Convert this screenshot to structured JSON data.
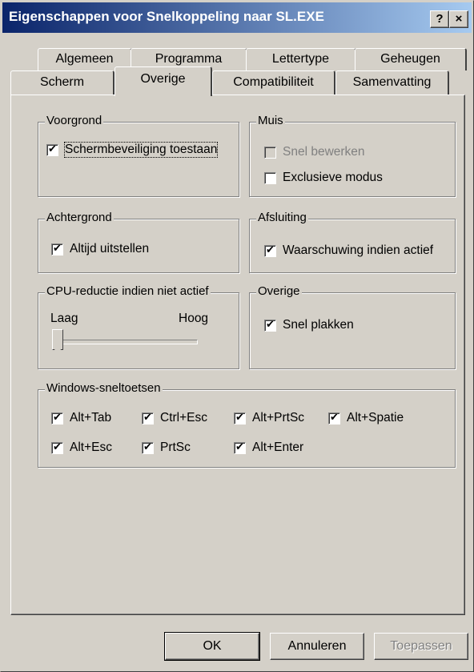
{
  "window": {
    "title": "Eigenschappen voor Snelkoppeling naar SL.EXE",
    "help_label": "?",
    "close_label": "×"
  },
  "tabs": {
    "row1": [
      "Algemeen",
      "Programma",
      "Lettertype",
      "Geheugen"
    ],
    "row2": [
      "Scherm",
      "Overige",
      "Compatibiliteit",
      "Samenvatting"
    ],
    "active": "Overige"
  },
  "voorgrond": {
    "label": "Voorgrond",
    "screensaver": {
      "label": "Schermbeveiliging toestaan",
      "checked": true
    }
  },
  "muis": {
    "label": "Muis",
    "quickedit": {
      "label": "Snel bewerken",
      "checked": false,
      "enabled": false
    },
    "exclusive": {
      "label": "Exclusieve modus",
      "checked": false
    }
  },
  "achtergrond": {
    "label": "Achtergrond",
    "always_suspend": {
      "label": "Altijd uitstellen",
      "checked": true
    }
  },
  "afsluiting": {
    "label": "Afsluiting",
    "warn": {
      "label": "Waarschuwing indien actief",
      "checked": true
    }
  },
  "cpu": {
    "label": "CPU-reductie indien niet actief",
    "low": "Laag",
    "high": "Hoog",
    "level": 0
  },
  "overige": {
    "label": "Overige",
    "fastpaste": {
      "label": "Snel plakken",
      "checked": true
    }
  },
  "shortcuts": {
    "label": "Windows-sneltoetsen",
    "items": [
      {
        "label": "Alt+Tab",
        "checked": true
      },
      {
        "label": "Ctrl+Esc",
        "checked": true
      },
      {
        "label": "Alt+PrtSc",
        "checked": true
      },
      {
        "label": "Alt+Spatie",
        "checked": true
      },
      {
        "label": "Alt+Esc",
        "checked": true
      },
      {
        "label": "PrtSc",
        "checked": true
      },
      {
        "label": "Alt+Enter",
        "checked": true
      }
    ]
  },
  "buttons": {
    "ok": "OK",
    "cancel": "Annuleren",
    "apply": "Toepassen"
  }
}
